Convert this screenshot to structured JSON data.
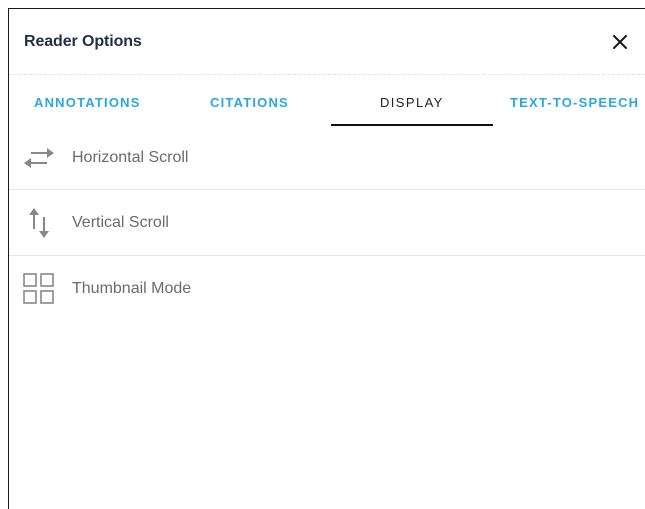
{
  "dialog": {
    "title": "Reader Options",
    "close_icon": "close-icon"
  },
  "tabs": [
    {
      "label": "ANNOTATIONS",
      "active": false
    },
    {
      "label": "CITATIONS",
      "active": false
    },
    {
      "label": "DISPLAY",
      "active": true
    },
    {
      "label": "TEXT-TO-SPEECH",
      "active": false
    }
  ],
  "display_options": [
    {
      "label": "Horizontal Scroll",
      "icon": "horizontal-arrows-icon"
    },
    {
      "label": "Vertical Scroll",
      "icon": "vertical-arrows-icon"
    },
    {
      "label": "Thumbnail Mode",
      "icon": "thumbnail-grid-icon"
    }
  ],
  "colors": {
    "tab_inactive": "#2aa8dd",
    "tab_active": "#222222",
    "title": "#1f2f45",
    "option_text": "#6b6b6b",
    "icon": "#888888"
  }
}
